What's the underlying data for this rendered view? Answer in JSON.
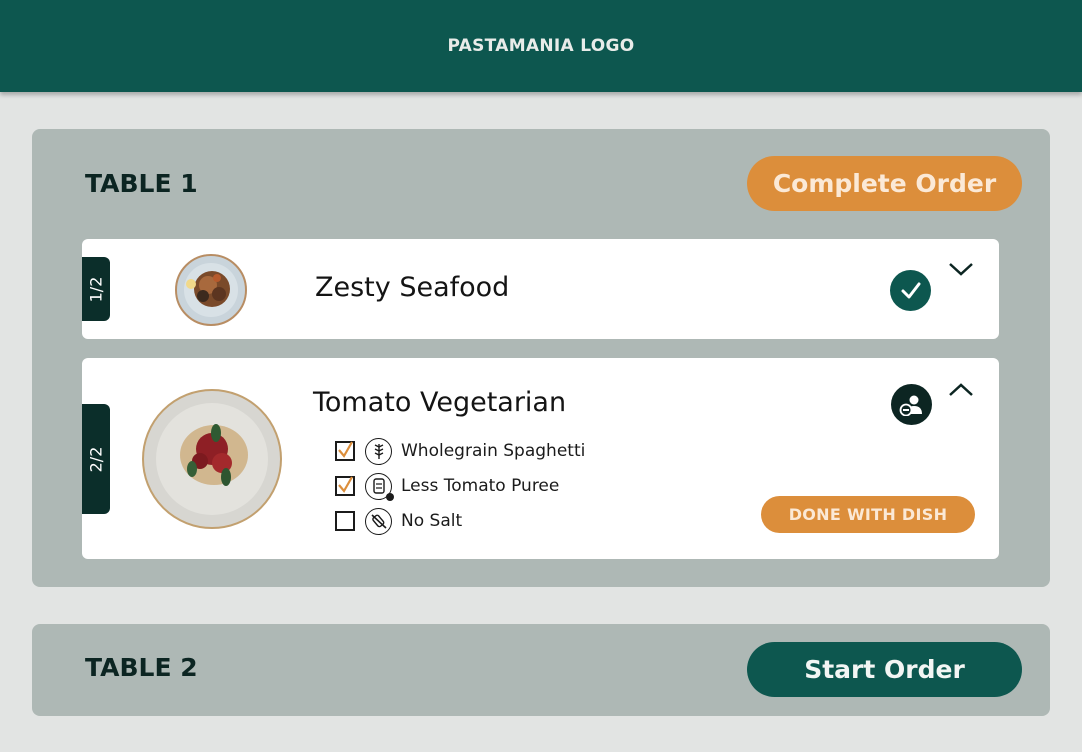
{
  "header": {
    "logo_text": "PASTAMANIA LOGO"
  },
  "tables": [
    {
      "title": "TABLE 1",
      "action_label": "Complete Order",
      "dishes": [
        {
          "position": "1/2",
          "name": "Zesty Seafood",
          "status": "completed",
          "expanded": false
        },
        {
          "position": "2/2",
          "name": "Tomato Vegetarian",
          "status": "in-progress",
          "expanded": true,
          "modifications": [
            {
              "label": "Wholegrain Spaghetti",
              "checked": true,
              "icon": "wheat-icon"
            },
            {
              "label": "Less Tomato Puree",
              "checked": true,
              "icon": "tomato-can-icon"
            },
            {
              "label": "No Salt",
              "checked": false,
              "icon": "no-salt-icon"
            }
          ],
          "done_label": "DONE WITH DISH"
        }
      ]
    },
    {
      "title": "TABLE 2",
      "action_label": "Start Order"
    }
  ],
  "colors": {
    "primary": "#0d574f",
    "accent": "#dc8e3b",
    "card_bg": "#aeb8b5",
    "page_bg": "#e2e4e3"
  }
}
